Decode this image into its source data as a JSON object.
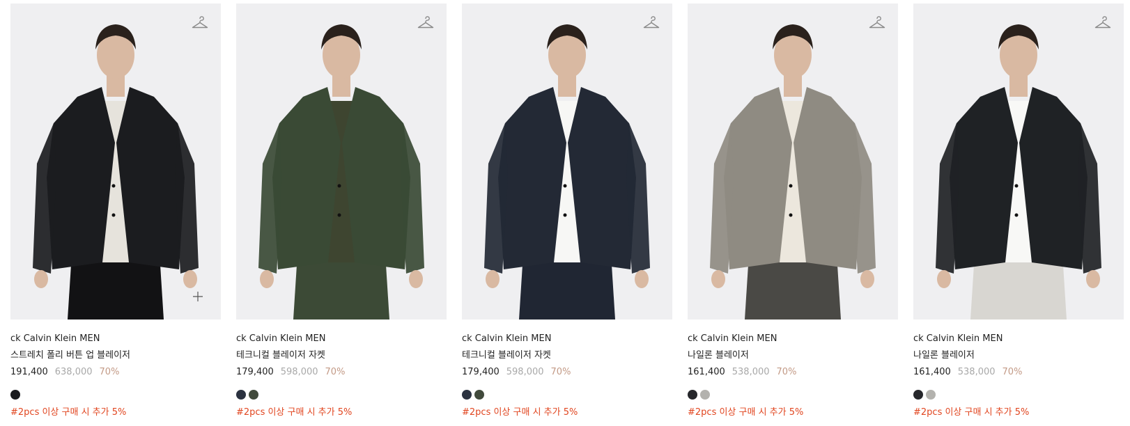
{
  "theme": {
    "tag_color": "#e1451f",
    "price_color": "#222222",
    "original_price_color": "#a8a8a8",
    "discount_color": "#c39a86",
    "photo_bg": "#efeff1"
  },
  "products": [
    {
      "brand": "ck Calvin Klein MEN",
      "name": "스트레치 폴리 버튼 업 블레이저",
      "price": "191,400",
      "original_price": "638,000",
      "discount": "70%",
      "promo": "#2pcs 이상 구매 시 추가 5%",
      "swatches": [
        "#1a1b1e"
      ],
      "jacket_color": "#1b1c1f",
      "shirt_color": "#e6e3dc",
      "pants_color": "#121214",
      "icons": [
        "hanger-icon",
        "plus-icon"
      ]
    },
    {
      "brand": "ck Calvin Klein MEN",
      "name": "테크니컬 블레이저 자켓",
      "price": "179,400",
      "original_price": "598,000",
      "discount": "70%",
      "promo": "#2pcs 이상 구매 시 추가 5%",
      "swatches": [
        "#2b3240",
        "#414a3c"
      ],
      "jacket_color": "#3a4a35",
      "shirt_color": "#3e4530",
      "pants_color": "#3c4a36",
      "icons": [
        "hanger-icon"
      ]
    },
    {
      "brand": "ck Calvin Klein MEN",
      "name": "테크니컬 블레이저 자켓",
      "price": "179,400",
      "original_price": "598,000",
      "discount": "70%",
      "promo": "#2pcs 이상 구매 시 추가 5%",
      "swatches": [
        "#2b3240",
        "#414a3c"
      ],
      "jacket_color": "#232935",
      "shirt_color": "#f7f7f5",
      "pants_color": "#202633",
      "icons": [
        "hanger-icon"
      ]
    },
    {
      "brand": "ck Calvin Klein MEN",
      "name": "나일론 블레이저",
      "price": "161,400",
      "original_price": "538,000",
      "discount": "70%",
      "promo": "#2pcs 이상 구매 시 추가 5%",
      "swatches": [
        "#26272b",
        "#b3b2ae"
      ],
      "jacket_color": "#8f8b82",
      "shirt_color": "#ece7dd",
      "pants_color": "#4a4945",
      "icons": [
        "hanger-icon"
      ]
    },
    {
      "brand": "ck Calvin Klein MEN",
      "name": "나일론 블레이저",
      "price": "161,400",
      "original_price": "538,000",
      "discount": "70%",
      "promo": "#2pcs 이상 구매 시 추가 5%",
      "swatches": [
        "#26272b",
        "#b3b2ae"
      ],
      "jacket_color": "#1f2225",
      "shirt_color": "#f8f8f6",
      "pants_color": "#d8d6d1",
      "icons": [
        "hanger-icon"
      ]
    }
  ]
}
